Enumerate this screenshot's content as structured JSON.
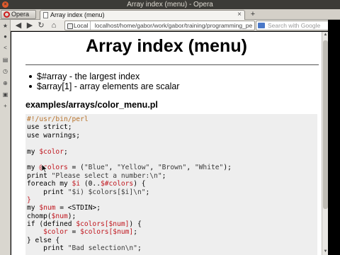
{
  "window": {
    "title": "Array index (menu) - Opera"
  },
  "tabs": {
    "opera_label": "Opera",
    "active_tab_label": "Array index (menu)",
    "close_glyph": "×",
    "new_tab_glyph": "+"
  },
  "toolbar": {
    "local_badge": "Local",
    "url": "localhost/home/gabor/work/gabor/training/programming_pe",
    "search_placeholder": "Search with Google"
  },
  "icons": {
    "back": "back-arrow-icon",
    "forward": "forward-arrow-icon",
    "reload": "reload-icon",
    "home": "home-icon"
  },
  "page": {
    "title": "Array index (menu)",
    "bullets": [
      "$#array - the largest index",
      "$array[1] - array elements are scalar"
    ],
    "filename": "examples/arrays/color_menu.pl",
    "code": [
      {
        "segs": [
          {
            "t": "#!/usr/bin/perl",
            "c": "c-shebang"
          }
        ]
      },
      {
        "segs": [
          {
            "t": "use strict;",
            "c": ""
          }
        ]
      },
      {
        "segs": [
          {
            "t": "use warnings;",
            "c": ""
          }
        ]
      },
      {
        "segs": [
          {
            "t": "",
            "c": ""
          }
        ]
      },
      {
        "segs": [
          {
            "t": "my ",
            "c": ""
          },
          {
            "t": "$color",
            "c": "c-red"
          },
          {
            "t": ";",
            "c": ""
          }
        ]
      },
      {
        "segs": [
          {
            "t": "",
            "c": ""
          }
        ]
      },
      {
        "segs": [
          {
            "t": "my ",
            "c": ""
          },
          {
            "t": "@colors",
            "c": "c-red"
          },
          {
            "t": " = (",
            "c": ""
          },
          {
            "t": "\"Blue\"",
            "c": "c-str"
          },
          {
            "t": ", ",
            "c": ""
          },
          {
            "t": "\"Yellow\"",
            "c": "c-str"
          },
          {
            "t": ", ",
            "c": ""
          },
          {
            "t": "\"Brown\"",
            "c": "c-str"
          },
          {
            "t": ", ",
            "c": ""
          },
          {
            "t": "\"White\"",
            "c": "c-str"
          },
          {
            "t": ");",
            "c": ""
          }
        ]
      },
      {
        "segs": [
          {
            "t": "print ",
            "c": ""
          },
          {
            "t": "\"Please select a number:\\n\"",
            "c": "c-str"
          },
          {
            "t": ";",
            "c": ""
          }
        ]
      },
      {
        "segs": [
          {
            "t": "foreach my ",
            "c": ""
          },
          {
            "t": "$i",
            "c": "c-red"
          },
          {
            "t": " (0..",
            "c": ""
          },
          {
            "t": "$#colors",
            "c": "c-red"
          },
          {
            "t": ") {",
            "c": ""
          }
        ]
      },
      {
        "segs": [
          {
            "t": "    print ",
            "c": ""
          },
          {
            "t": "\"$i) $colors[$i]\\n\"",
            "c": "c-str"
          },
          {
            "t": ";",
            "c": ""
          }
        ]
      },
      {
        "segs": [
          {
            "t": "}",
            "c": "c-red"
          }
        ]
      },
      {
        "segs": [
          {
            "t": "my ",
            "c": ""
          },
          {
            "t": "$num",
            "c": "c-red"
          },
          {
            "t": " = <STDIN>;",
            "c": ""
          }
        ]
      },
      {
        "segs": [
          {
            "t": "chomp(",
            "c": ""
          },
          {
            "t": "$num",
            "c": "c-red"
          },
          {
            "t": ");",
            "c": ""
          }
        ]
      },
      {
        "segs": [
          {
            "t": "if (defined ",
            "c": ""
          },
          {
            "t": "$colors[$num]",
            "c": "c-red"
          },
          {
            "t": ") {",
            "c": ""
          }
        ]
      },
      {
        "segs": [
          {
            "t": "    ",
            "c": ""
          },
          {
            "t": "$color",
            "c": "c-red"
          },
          {
            "t": " = ",
            "c": ""
          },
          {
            "t": "$colors[$num]",
            "c": "c-red"
          },
          {
            "t": ";",
            "c": ""
          }
        ]
      },
      {
        "segs": [
          {
            "t": "} else {",
            "c": ""
          }
        ]
      },
      {
        "segs": [
          {
            "t": "    print ",
            "c": ""
          },
          {
            "t": "\"Bad selection\\n\"",
            "c": "c-str"
          },
          {
            "t": ";",
            "c": ""
          }
        ]
      }
    ]
  },
  "colors": {
    "accent_red": "#c0161e",
    "shebang": "#b8732b",
    "code_bg": "#eeeeee"
  }
}
